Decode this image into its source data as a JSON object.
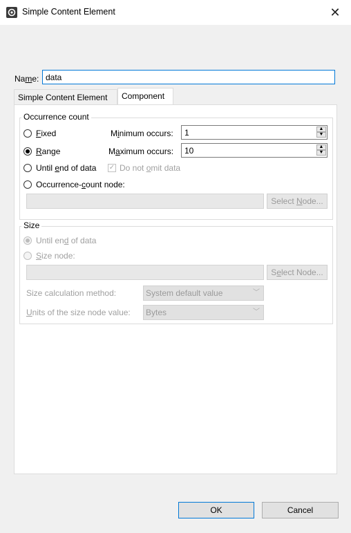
{
  "window": {
    "title": "Simple Content Element",
    "close_glyph": "✕"
  },
  "name": {
    "label_pre": "Na",
    "label_u": "m",
    "label_post": "e:",
    "value": "data"
  },
  "tabs": [
    {
      "label": "Simple Content Element",
      "active": false
    },
    {
      "label": "Component",
      "active": true
    }
  ],
  "occurrence": {
    "group_label": "Occurrence count",
    "fixed": {
      "u": "F",
      "rest": "ixed"
    },
    "range": {
      "u": "R",
      "rest": "ange"
    },
    "until_end": {
      "pre": "Until ",
      "u": "e",
      "rest": "nd of data"
    },
    "occ_node": {
      "pre": "Occurrence-",
      "u": "c",
      "rest": "ount node:"
    },
    "min_label": {
      "pre": "M",
      "u": "i",
      "rest": "nimum occurs:"
    },
    "min_value": "1",
    "max_label": {
      "pre": "M",
      "u": "a",
      "rest": "ximum occurs:"
    },
    "max_value": "10",
    "omit": {
      "pre": "Do not ",
      "u": "o",
      "rest": "mit data"
    },
    "select_node": {
      "pre": "Select ",
      "u": "N",
      "rest": "ode..."
    }
  },
  "size": {
    "group_label": "Size",
    "until_end": {
      "pre": "Until en",
      "u": "d",
      "rest": " of data"
    },
    "size_node": {
      "pre": "",
      "u": "S",
      "rest": "ize node:"
    },
    "select_node": {
      "pre": "S",
      "u": "e",
      "rest": "lect Node..."
    },
    "calc_label": "Size calculation method:",
    "calc_value": "System default value",
    "units_label": {
      "pre": "",
      "u": "U",
      "rest": "nits of the size node value:"
    },
    "units_value": "Bytes"
  },
  "buttons": {
    "ok": "OK",
    "cancel": "Cancel"
  },
  "colors": {
    "accent": "#0078d7"
  }
}
